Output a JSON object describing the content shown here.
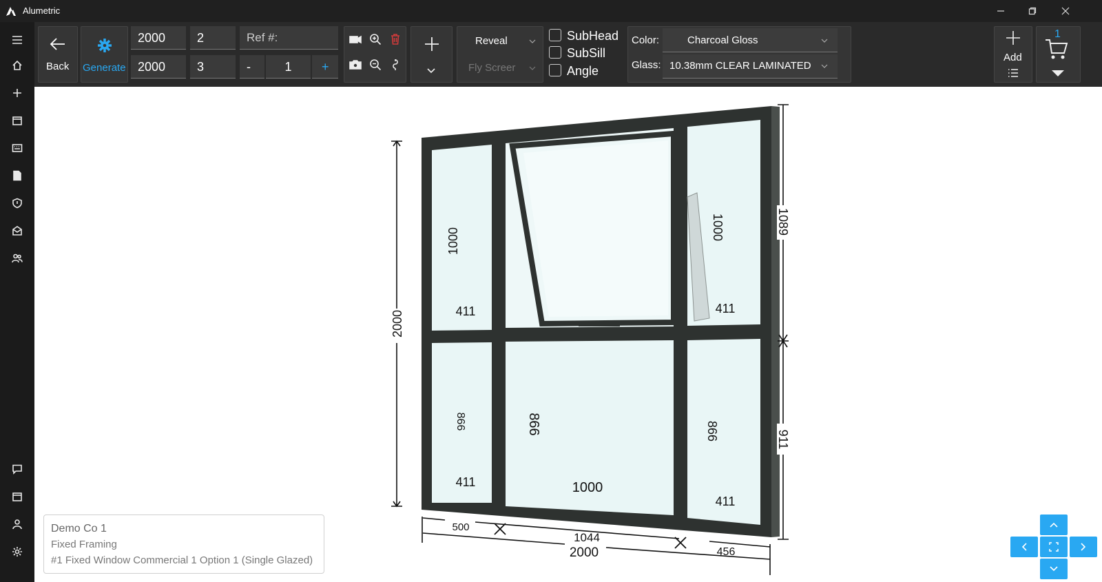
{
  "app": {
    "title": "Alumetric"
  },
  "toolbar": {
    "back_label": "Back",
    "generate_label": "Generate",
    "width_top": "2000",
    "width_bottom": "2000",
    "cols_value": "2",
    "rows_value": "3",
    "ref_placeholder": "Ref #:",
    "qty_minus": "-",
    "qty_value": "1",
    "qty_plus": "+",
    "reveal_label": "Reveal",
    "flyscreen_label": "Fly Screer",
    "subhead_label": "SubHead",
    "subsill_label": "SubSill",
    "angle_label": "Angle",
    "color_label": "Color:",
    "color_value": "Charcoal Gloss",
    "glass_label": "Glass:",
    "glass_value": "10.38mm CLEAR LAMINATED",
    "add_label": "Add",
    "cart_count": "1"
  },
  "info": {
    "company": "Demo Co 1",
    "type": "Fixed Framing",
    "item": "#1 Fixed Window Commercial 1 Option 1 (Single Glazed)"
  },
  "drawing": {
    "overall_height": "2000",
    "top_right_height": "1089",
    "bottom_right_height": "911",
    "bottom_width_left": "500",
    "bottom_width_mid": "1044",
    "bottom_width_right": "456",
    "bottom_width_total": "2000",
    "pane_tl_h": "1000",
    "pane_tl_w": "411",
    "pane_tr_h": "1000",
    "pane_tr_w": "411",
    "pane_bl_h": "866",
    "pane_bl_w": "411",
    "pane_bm_h": "866",
    "pane_bm_w": "1000",
    "pane_br_h": "866",
    "pane_br_w": "411"
  },
  "colors": {
    "accent": "#29a8f2",
    "toolbar_bg": "#2a2a2a",
    "titlebar_bg": "#202020",
    "frame": "#2e3230",
    "glass": "#e9f6f6",
    "delete": "#d23b3b"
  }
}
